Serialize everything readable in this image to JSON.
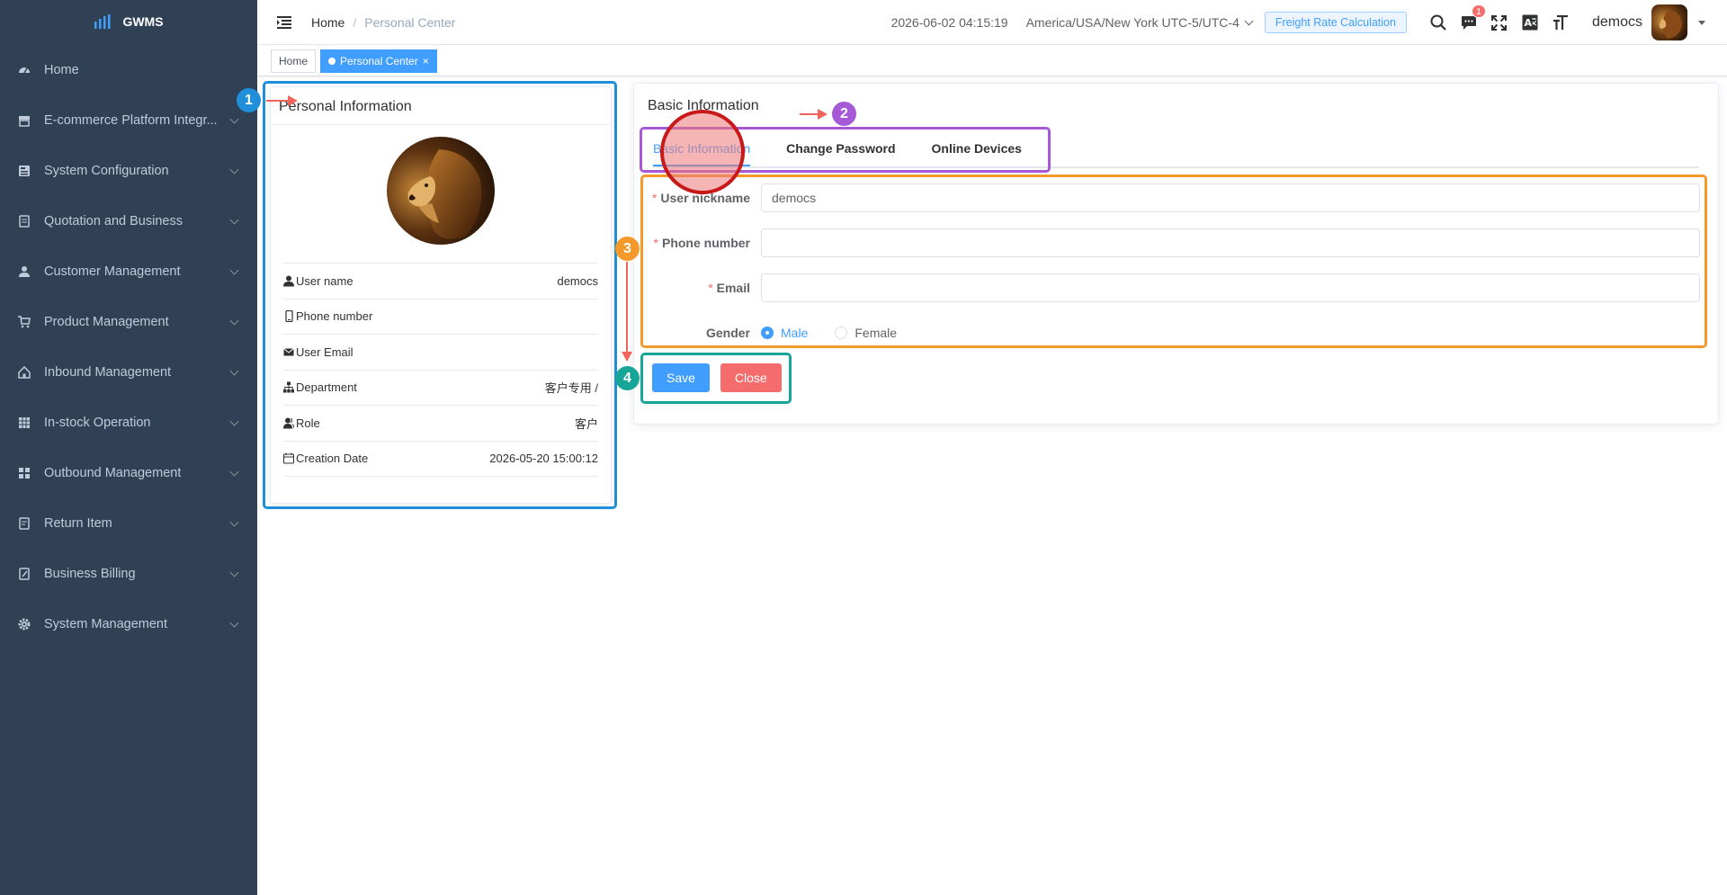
{
  "app": {
    "name": "GWMS"
  },
  "sidebar": {
    "items": [
      {
        "label": "Home",
        "icon": "dashboard-icon",
        "has_children": false
      },
      {
        "label": "E-commerce Platform Integr...",
        "icon": "shop-icon",
        "has_children": true
      },
      {
        "label": "System Configuration",
        "icon": "config-icon",
        "has_children": true
      },
      {
        "label": "Quotation and Business",
        "icon": "document-icon",
        "has_children": true
      },
      {
        "label": "Customer Management",
        "icon": "user-icon",
        "has_children": true
      },
      {
        "label": "Product Management",
        "icon": "cart-icon",
        "has_children": true
      },
      {
        "label": "Inbound Management",
        "icon": "house-icon",
        "has_children": true
      },
      {
        "label": "In-stock Operation",
        "icon": "table-icon",
        "has_children": true
      },
      {
        "label": "Outbound Management",
        "icon": "grid-icon",
        "has_children": true
      },
      {
        "label": "Return Item",
        "icon": "return-icon",
        "has_children": true
      },
      {
        "label": "Business Billing",
        "icon": "billing-icon",
        "has_children": true
      },
      {
        "label": "System Management",
        "icon": "gear-icon",
        "has_children": true
      }
    ]
  },
  "header": {
    "breadcrumb": {
      "home": "Home",
      "separator": "/",
      "current": "Personal Center"
    },
    "datetime": "2026-06-02 04:15:19",
    "timezone": "America/USA/New York UTC-5/UTC-4",
    "freight_button": "Freight Rate Calculation",
    "notification_count": "1",
    "username": "democs"
  },
  "tags": {
    "home": "Home",
    "active": "Personal Center",
    "close": "×"
  },
  "profile_card": {
    "title": "Personal Information",
    "rows": [
      {
        "label": "User name",
        "value": "democs",
        "icon": "user-icon"
      },
      {
        "label": "Phone number",
        "value": "",
        "icon": "phone-icon"
      },
      {
        "label": "User Email",
        "value": "",
        "icon": "mail-icon"
      },
      {
        "label": "Department",
        "value": "客户专用 /",
        "icon": "tree-icon"
      },
      {
        "label": "Role",
        "value": "客户",
        "icon": "peoples-icon"
      },
      {
        "label": "Creation Date",
        "value": "2026-05-20 15:00:12",
        "icon": "date-icon"
      }
    ]
  },
  "basic_card": {
    "title": "Basic Information",
    "tabs": [
      "Basic Information",
      "Change Password",
      "Online Devices"
    ],
    "active_tab": 0,
    "form": {
      "nickname": {
        "label": "User nickname",
        "value": "democs",
        "required": true
      },
      "phone": {
        "label": "Phone number",
        "value": "",
        "required": true
      },
      "email": {
        "label": "Email",
        "value": "",
        "required": true
      },
      "gender": {
        "label": "Gender",
        "options": [
          "Male",
          "Female"
        ],
        "selected": "Male"
      }
    },
    "buttons": {
      "save": "Save",
      "close": "Close"
    }
  },
  "annotations": [
    {
      "number": "1",
      "color": "#1e8fd8"
    },
    {
      "number": "2",
      "color": "#a659d6"
    },
    {
      "number": "3",
      "color": "#f39a2b"
    },
    {
      "number": "4",
      "color": "#17a59a"
    }
  ],
  "colors": {
    "sidebar_bg": "#304156",
    "primary": "#409eff",
    "danger": "#f56c6c"
  }
}
